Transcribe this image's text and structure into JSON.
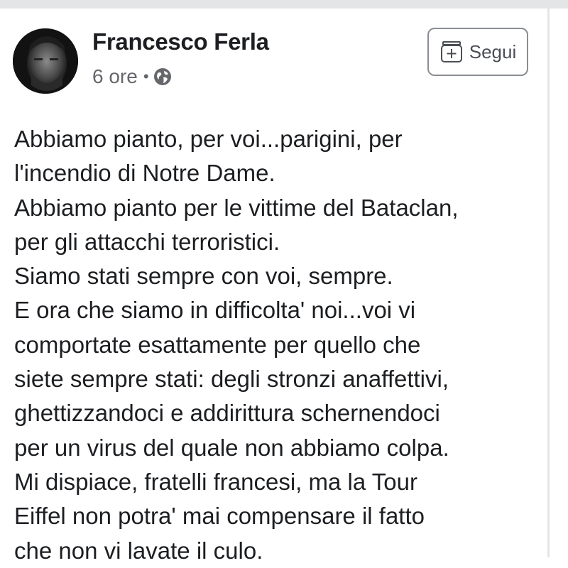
{
  "post": {
    "author": "Francesco Ferla",
    "time": "6 ore",
    "separator": "•",
    "privacy_icon": "globe-icon",
    "follow_label": "Segui",
    "follow_icon": "follow-page-plus-icon",
    "lines": [
      "Abbiamo pianto, per voi...parigini, per",
      "l'incendio di Notre Dame.",
      "Abbiamo pianto per le vittime del Bataclan,",
      "per gli attacchi terroristici.",
      "Siamo stati sempre con voi, sempre.",
      "E ora che siamo in difficolta' noi...voi vi",
      "comportate esattamente per quello che",
      "siete sempre stati: degli stronzi anaffettivi,",
      "ghettizzandoci e addirittura schernendoci",
      "per un virus del quale non abbiamo colpa.",
      "Mi dispiace, fratelli francesi, ma la Tour",
      "Eiffel non potra' mai compensare il fatto",
      "che non vi lavate il culo."
    ]
  },
  "colors": {
    "text": "#1c1e21",
    "secondary_text": "#65676b",
    "border": "#e4e5e7",
    "button_border": "#8a8d91"
  }
}
